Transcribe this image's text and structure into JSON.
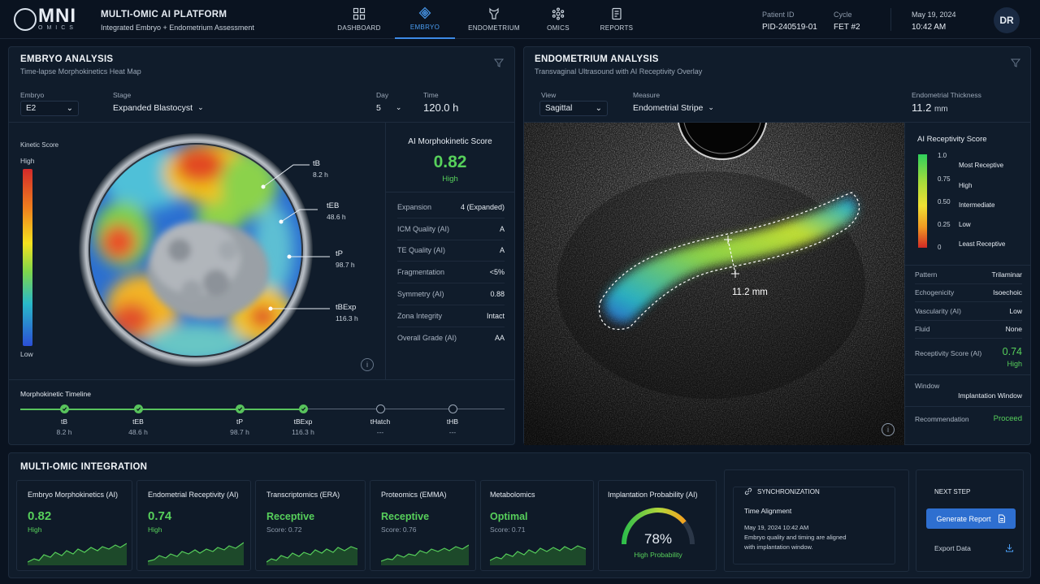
{
  "app": {
    "logo_main": "MNI",
    "logo_sub": "OMICS",
    "title": "MULTI-OMIC AI PLATFORM",
    "subtitle": "Integrated Embryo + Endometrium Assessment"
  },
  "nav": {
    "items": [
      {
        "label": "DASHBOARD",
        "icon": "grid-icon",
        "active": false
      },
      {
        "label": "EMBRYO",
        "icon": "embryo-icon",
        "active": true
      },
      {
        "label": "ENDOMETRIUM",
        "icon": "endometrium-icon",
        "active": false
      },
      {
        "label": "OMICS",
        "icon": "molecule-icon",
        "active": false
      },
      {
        "label": "REPORTS",
        "icon": "report-icon",
        "active": false
      }
    ]
  },
  "patient": {
    "id_label": "Patient ID",
    "id": "PID-240519-01",
    "cycle_label": "Cycle",
    "cycle": "FET #2",
    "date": "May 19, 2024",
    "time": "10:42 AM",
    "initials": "DR"
  },
  "embryo": {
    "title": "EMBRYO ANALYSIS",
    "subtitle": "Time-lapse Morphokinetics Heat Map",
    "embryo_label": "Embryo",
    "embryo_value": "E2",
    "stage_label": "Stage",
    "stage_value": "Expanded Blastocyst",
    "day_label": "Day",
    "day_value": "5",
    "time_label": "Time",
    "time_value": "120.0 h",
    "kinetic_label": "Kinetic Score",
    "kinetic_high": "High",
    "kinetic_low": "Low",
    "callouts": [
      {
        "name": "tB",
        "time": "8.2 h"
      },
      {
        "name": "tEB",
        "time": "48.6 h"
      },
      {
        "name": "tP",
        "time": "98.7 h"
      },
      {
        "name": "tBExp",
        "time": "116.3 h"
      }
    ],
    "score_title": "AI Morphokinetic Score",
    "score_value": "0.82",
    "score_level": "High",
    "metrics": [
      {
        "label": "Expansion",
        "value": "4 (Expanded)",
        "accent": false
      },
      {
        "label": "ICM Quality (AI)",
        "value": "A",
        "accent": true
      },
      {
        "label": "TE Quality (AI)",
        "value": "A",
        "accent": true
      },
      {
        "label": "Fragmentation",
        "value": "<5%",
        "accent": false
      },
      {
        "label": "Symmetry (AI)",
        "value": "0.88",
        "accent": true
      },
      {
        "label": "Zona Integrity",
        "value": "Intact",
        "accent": false
      },
      {
        "label": "Overall Grade (AI)",
        "value": "AA",
        "accent": true
      }
    ],
    "timeline_title": "Morphokinetic Timeline",
    "timeline": [
      {
        "label": "tB",
        "time": "8.2 h",
        "done": true
      },
      {
        "label": "tEB",
        "time": "48.6 h",
        "done": true
      },
      {
        "label": "tP",
        "time": "98.7 h",
        "done": true
      },
      {
        "label": "tBExp",
        "time": "116.3 h",
        "done": true
      },
      {
        "label": "tHatch",
        "time": "---",
        "done": false
      },
      {
        "label": "tHB",
        "time": "---",
        "done": false
      }
    ]
  },
  "endometrium": {
    "title": "ENDOMETRIUM ANALYSIS",
    "subtitle": "Transvaginal Ultrasound with AI Receptivity Overlay",
    "view_label": "View",
    "view_value": "Sagittal",
    "measure_label": "Measure",
    "measure_value": "Endometrial Stripe",
    "thickness_label": "Endometrial Thickness",
    "thickness_value": "11.2",
    "thickness_unit": "mm",
    "measurement_label": "11.2 mm",
    "legend_title": "AI Receptivity Score",
    "legend_ticks": [
      "1.0",
      "0.75",
      "0.50",
      "0.25",
      "0"
    ],
    "legend_levels": [
      "Most Receptive",
      "High",
      "Intermediate",
      "Low",
      "Least Receptive"
    ],
    "props": [
      {
        "label": "Pattern",
        "value": "Trilaminar"
      },
      {
        "label": "Echogenicity",
        "value": "Isoechoic"
      },
      {
        "label": "Vascularity (AI)",
        "value": "Low"
      },
      {
        "label": "Fluid",
        "value": "None"
      }
    ],
    "receptivity_label": "Receptivity Score (AI)",
    "receptivity_value": "0.74",
    "receptivity_level": "High",
    "window_label": "Window",
    "window_value": "Implantation Window",
    "recommendation_label": "Recommendation",
    "recommendation_value": "Proceed"
  },
  "integration": {
    "title": "MULTI-OMIC INTEGRATION",
    "cards": [
      {
        "title": "Embryo Morphokinetics (AI)",
        "value": "0.82",
        "sub": "High"
      },
      {
        "title": "Endometrial Receptivity (AI)",
        "value": "0.74",
        "sub": "High"
      },
      {
        "title": "Transcriptomics (ERA)",
        "value": "Receptive",
        "sub": "Score: 0.72"
      },
      {
        "title": "Proteomics (EMMA)",
        "value": "Receptive",
        "sub": "Score: 0.76"
      },
      {
        "title": "Metabolomics",
        "value": "Optimal",
        "sub": "Score: 0.71"
      }
    ],
    "probability_title": "Implantation Probability (AI)",
    "probability_value": "78%",
    "probability_fraction": 0.78,
    "probability_label": "High Probability",
    "sync_title": "SYNCHRONIZATION",
    "sync_subtitle": "Time Alignment",
    "sync_line1": "May 19, 2024 10:42 AM",
    "sync_line2": "Embryo quality and timing are aligned",
    "sync_line3": "with implantation window.",
    "next_title": "NEXT STEP",
    "generate_label": "Generate Report",
    "export_label": "Export Data"
  }
}
